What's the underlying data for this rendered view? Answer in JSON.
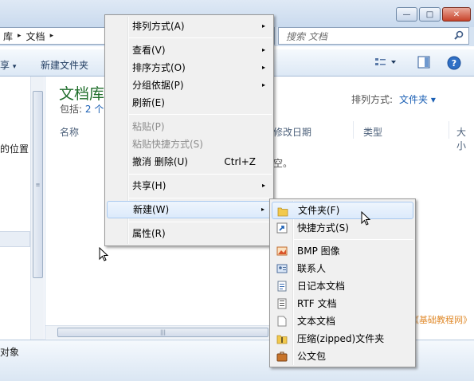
{
  "window": {
    "minimize_glyph": "—",
    "maximize_glyph": "□",
    "close_glyph": "✕"
  },
  "address": {
    "crumb1": "库",
    "crumb2": "文档",
    "sep": "▸",
    "search_placeholder": "搜索 文档"
  },
  "toolbar": {
    "share_label": "享",
    "share_arrow": "▾",
    "new_folder_label": "新建文件夹",
    "icons": [
      "view-options-icon",
      "preview-pane-icon",
      "help-icon"
    ]
  },
  "nav": {
    "partial_text": "的位置"
  },
  "library": {
    "title": "文档库",
    "includes_prefix": "包括:",
    "includes_link": "2 个",
    "arrange_label": "排列方式:",
    "arrange_value": "文件夹 ▾"
  },
  "columns": [
    "名称",
    "修改日期",
    "类型",
    "大小"
  ],
  "empty_text": "空。",
  "status": {
    "text": "对象"
  },
  "watermark": "《基础教程网》",
  "context_menu": {
    "items": [
      {
        "label": "排列方式(A)",
        "arrow": "▸"
      },
      {
        "label": "查看(V)",
        "arrow": "▸"
      },
      {
        "label": "排序方式(O)",
        "arrow": "▸"
      },
      {
        "label": "分组依据(P)",
        "arrow": "▸"
      },
      {
        "label": "刷新(E)"
      },
      {
        "label": "粘贴(P)"
      },
      {
        "label": "粘贴快捷方式(S)"
      },
      {
        "label": "撤消 删除(U)",
        "shortcut": "Ctrl+Z"
      },
      {
        "label": "共享(H)",
        "arrow": "▸"
      },
      {
        "label": "新建(W)",
        "arrow": "▸"
      },
      {
        "label": "属性(R)"
      }
    ]
  },
  "new_submenu": {
    "items": [
      {
        "label": "文件夹(F)",
        "icon": "folder-icon"
      },
      {
        "label": "快捷方式(S)",
        "icon": "shortcut-icon"
      },
      {
        "label": "BMP 图像",
        "icon": "bmp-image-icon"
      },
      {
        "label": "联系人",
        "icon": "contact-icon"
      },
      {
        "label": "日记本文档",
        "icon": "journal-icon"
      },
      {
        "label": "RTF 文档",
        "icon": "rtf-document-icon"
      },
      {
        "label": "文本文档",
        "icon": "text-document-icon"
      },
      {
        "label": "压缩(zipped)文件夹",
        "icon": "zip-folder-icon"
      },
      {
        "label": "公文包",
        "icon": "briefcase-icon"
      }
    ]
  },
  "colors": {
    "title_green": "#1f6e2b",
    "link_blue": "#1a5fb4",
    "highlight_border": "#a9c9ef",
    "menu_bg": "#f0f0f0",
    "watermark": "#e08a2b"
  }
}
